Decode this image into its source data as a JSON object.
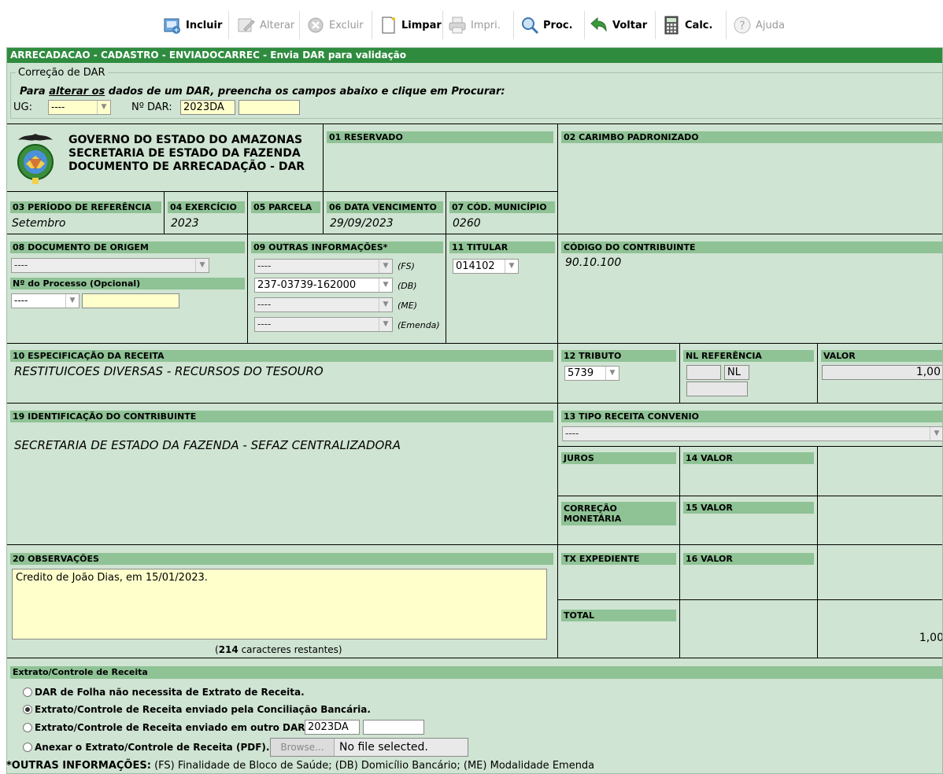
{
  "toolbar": {
    "incluir": "Incluir",
    "alterar": "Alterar",
    "excluir": "Excluir",
    "limpar": "Limpar",
    "imprimir": "Impri.",
    "procurar": "Proc.",
    "voltar": "Voltar",
    "calc": "Calc.",
    "ajuda": "Ajuda"
  },
  "window": {
    "title": "ARRECADACAO - CADASTRO - ENVIADOCARREC - Envia DAR para validação"
  },
  "correcao": {
    "legend": "Correção de DAR",
    "instruction_prefix": "Para ",
    "instruction_underlined": "alterar os",
    "instruction_suffix": " dados de um DAR, preencha os campos abaixo e clique em Procurar:",
    "ug_label": "UG:",
    "ug_value": "----",
    "ndar_label": "Nº DAR:",
    "ndar_prefix": "2023DA",
    "ndar_value": ""
  },
  "header": {
    "line1": "GOVERNO DO ESTADO DO AMAZONAS",
    "line2": "SECRETARIA DE ESTADO DA FAZENDA",
    "line3": "DOCUMENTO DE ARRECADAÇÃO - DAR",
    "f01": "01 RESERVADO",
    "f02": "02 CARIMBO PADRONIZADO"
  },
  "row2": {
    "f03_label": "03 PERÍODO DE REFERÊNCIA",
    "f03_value": "Setembro",
    "f04_label": "04 EXERCÍCIO",
    "f04_value": "2023",
    "f05_label": "05 PARCELA",
    "f05_value": "",
    "f06_label": "06 DATA VENCIMENTO",
    "f06_value": "29/09/2023",
    "f07_label": "07 CÓD. MUNICÍPIO",
    "f07_value": "0260"
  },
  "row3": {
    "f08_label": "08 DOCUMENTO DE ORIGEM",
    "f08_value": "----",
    "processo_label": "Nº do Processo (Opcional)",
    "processo_select": "----",
    "processo_value": "",
    "f09_label": "09 OUTRAS INFORMAÇÕES*",
    "fs_value": "----",
    "fs_tag": "(FS)",
    "db_value": "237-03739-162000",
    "db_tag": "(DB)",
    "me_value": "----",
    "me_tag": "(ME)",
    "emenda_value": "----",
    "emenda_tag": "(Emenda)",
    "f11_label": "11 TITULAR",
    "f11_value": "014102",
    "contrib_label": "CÓDIGO DO CONTRIBUINTE",
    "contrib_value": "90.10.100"
  },
  "row4": {
    "f10_label": "10 ESPECIFICAÇÃO DA RECEITA",
    "f10_value": "RESTITUICOES DIVERSAS - RECURSOS DO TESOURO",
    "f12_label": "12 TRIBUTO",
    "f12_value": "5739",
    "nl_label": "NL REFERÊNCIA",
    "nl_prefix": "",
    "nl_tag": "NL",
    "nl_value": "",
    "valor_label": "VALOR",
    "valor_value": "1,00"
  },
  "row5": {
    "f19_label": "19 IDENTIFICAÇÃO DO CONTRIBUINTE",
    "f19_value": "SECRETARIA DE ESTADO DA FAZENDA - SEFAZ CENTRALIZADORA",
    "f13_label": "13 TIPO RECEITA CONVENIO",
    "f13_value": "----",
    "juros_label": "JUROS",
    "f14_label": "14 VALOR",
    "correcao_label1": "CORREÇÃO",
    "correcao_label2": "MONETÁRIA",
    "f15_label": "15 VALOR"
  },
  "row6": {
    "f20_label": "20 OBSERVAÇÕES",
    "f20_value": "Credito de João Dias, em 15/01/2023.",
    "remaining_open": "(",
    "remaining_count": "214",
    "remaining_text": " caracteres restantes)",
    "txexp_label": "TX EXPEDIENTE",
    "f16_label": "16 VALOR",
    "total_label": "TOTAL",
    "total_value": "1,00"
  },
  "extrato": {
    "title": "Extrato/Controle de Receita",
    "opt1": "DAR de Folha não necessita de Extrato de Receita.",
    "opt2": "Extrato/Controle de Receita enviado pela Conciliação Bancária.",
    "opt3": "Extrato/Controle de Receita enviado em outro DAR.",
    "opt3_prefix": "2023DA",
    "opt3_value": "",
    "opt4": "Anexar o Extrato/Controle de Receita (PDF).",
    "browse": "Browse...",
    "nofile": "No file selected."
  },
  "footer": {
    "bold": "*OUTRAS INFORMAÇÕES:",
    "text": " (FS) Finalidade de Bloco de Saúde; (DB) Domicílio Bancário; (ME) Modalidade Emenda"
  },
  "colors": {
    "title_bar": "#2f8c3f",
    "panel_bg": "#cfe4d2",
    "label_bar": "#8fc295",
    "input_yellow": "#ffffcc"
  }
}
